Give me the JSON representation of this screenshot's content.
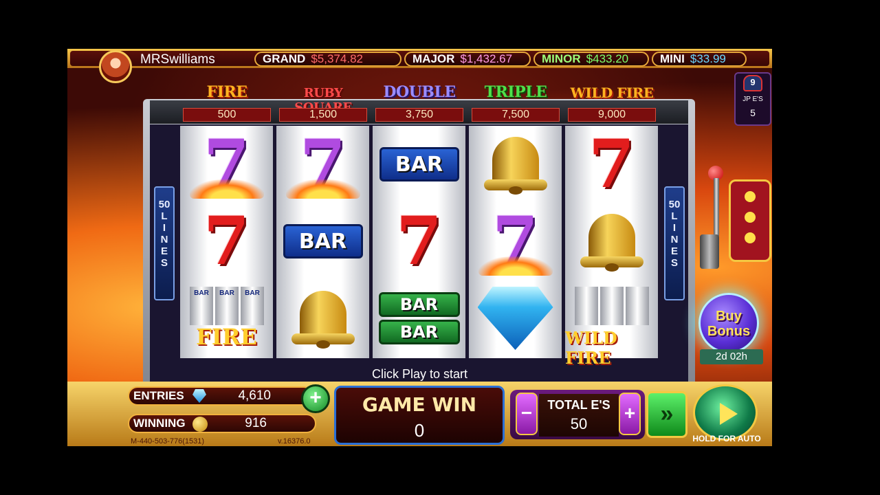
{
  "header": {
    "username": "MRSwilliams",
    "jackpots": [
      {
        "label": "GRAND",
        "value": "$5,374.82",
        "color": "#ff6b6b"
      },
      {
        "label": "MAJOR",
        "value": "$1,432.67",
        "color": "#ff9ae6"
      },
      {
        "label": "MINOR",
        "value": "$433.20",
        "color": "#7dff6b"
      },
      {
        "label": "MINI",
        "value": "$33.99",
        "color": "#6bd6ff"
      }
    ]
  },
  "reel_titles": [
    {
      "name": "FIRE",
      "value": "500",
      "color": "#ffb320"
    },
    {
      "name": "RUBY SQUARE",
      "value": "1,500",
      "color": "#ff4a4a"
    },
    {
      "name": "DOUBLE",
      "value": "3,750",
      "color": "#9b8cff"
    },
    {
      "name": "TRIPLE",
      "value": "7,500",
      "color": "#4ee04a"
    },
    {
      "name": "WILD FIRE",
      "value": "9,000",
      "color": "#ffb320"
    }
  ],
  "lines_label": [
    "50",
    "L",
    "I",
    "N",
    "E",
    "S"
  ],
  "reels": [
    [
      "purple-seven-flame",
      "red-seven",
      "fire-logo"
    ],
    [
      "purple-seven-flame",
      "bar",
      "bell"
    ],
    [
      "bar",
      "red-seven",
      "double-bar"
    ],
    [
      "bell",
      "purple-seven-flame",
      "diamond"
    ],
    [
      "red-seven",
      "bell",
      "wild-fire-logo"
    ]
  ],
  "symbol_text": {
    "seven": "7",
    "bar": "BAR",
    "fire": "FIRE",
    "wild_fire": "WILD FIRE",
    "mini_bar": "BAR"
  },
  "jp_es": {
    "badge": "9",
    "label": "JP E'S",
    "value": "5"
  },
  "buy_bonus": {
    "line1": "Buy",
    "line2": "Bonus",
    "timer": "2d 02h"
  },
  "status_text": "Click Play to start",
  "bottom": {
    "entries_label": "ENTRIES",
    "entries_value": "4,610",
    "winning_label": "WINNING",
    "winning_value": "916",
    "plus": "+",
    "game_win_label": "GAME WIN",
    "game_win_value": "0",
    "minus": "−",
    "total_label": "TOTAL E'S",
    "total_value": "50",
    "total_plus": "+",
    "fast_icon": "»",
    "hold_auto": "HOLD FOR AUTO",
    "machine_id": "M-440-503-776(1531)",
    "version": "v.16376.0"
  }
}
